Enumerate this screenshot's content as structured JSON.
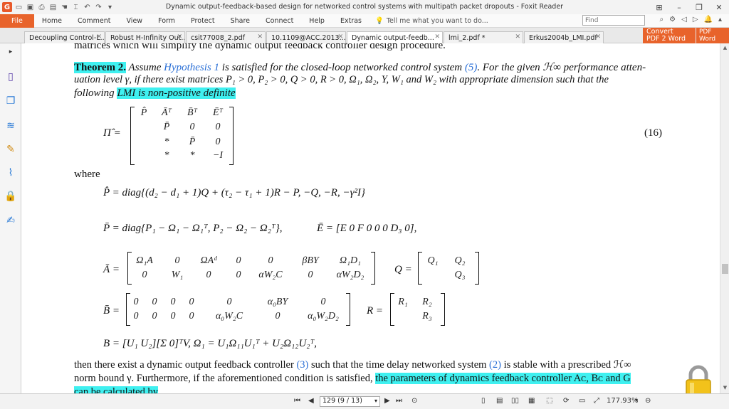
{
  "window": {
    "title": "Dynamic output-feedback-based  design for networked control systems with multipath packet dropouts - Foxit Reader"
  },
  "ribbon": {
    "tabs": [
      "File",
      "Home",
      "Comment",
      "View",
      "Form",
      "Protect",
      "Share",
      "Connect",
      "Help",
      "Extras"
    ],
    "tell_me": "Tell me what you want to do...",
    "find_placeholder": "Find"
  },
  "doc_tabs": [
    {
      "label": "Decoupling Control-L...",
      "active": false
    },
    {
      "label": "Robust H-Infinity Out...",
      "active": false
    },
    {
      "label": "csit77008_2.pdf",
      "active": false
    },
    {
      "label": "10.1109@ACC.2013....",
      "active": false
    },
    {
      "label": "Dynamic output-feedb...",
      "active": true
    },
    {
      "label": "lmi_2.pdf *",
      "active": false
    },
    {
      "label": "Erkus2004b_LMI.pdf",
      "active": false
    }
  ],
  "convert": {
    "line1": "Convert",
    "line2": "PDF 2 Word",
    "badge1": "PDF",
    "badge2": "Word"
  },
  "content": {
    "line0": "matrices which will simplify the dynamic output feedback controller design procedure.",
    "theorem_label": "Theorem 2.",
    "theorem_t1": " Assume ",
    "hyp_link": "Hypothesis 1",
    "theorem_t2": " is satisfied for the closed-loop networked control system ",
    "eq5_link": "(5)",
    "theorem_t3": ". For the given ℋ∞ performance atten-",
    "line2": "uation level γ, if there exist matrices P₁ > 0, P₂ > 0, Q > 0, R > 0, Ω₁, Ω₂, Y, W₁ and W₂ with appropriate dimension such that the",
    "line3_a": "following ",
    "line3_hl": "LMI is non-positive definite",
    "eq_number": "(16)",
    "where": "where",
    "phat": "P̂ = diag{(d₂ − d₁ + 1)Q + (τ₂ − τ₁ + 1)R − P,    −Q,    −R,    −γ²I}",
    "pbar": "P̄ = diag{P₁ − Ω₁ − Ω₁ᵀ,    P₂ − Ω₂ − Ω₂ᵀ},",
    "ebar": "Ē = [E    0    F    0    0    0    D₃    0],",
    "bdef": "B = [U₁   U₂][Σ   0]ᵀV,    Ω₁ = U₁Ω₁₁U₁ᵀ + U₂Ω₁₂U₂ᵀ,",
    "then1_a": "then there exist a dynamic output feedback controller ",
    "eq3_link": "(3)",
    "then1_b": " such that the time delay networked system ",
    "eq2_link": "(2)",
    "then1_c": " is stable with a prescribed ℋ∞",
    "then2_a": "norm bound γ. Furthermore, if the aforementioned condition is satisfied, ",
    "then2_hl": "the parameters of dynamics feedback controller Aᴄ, Bᴄ and G",
    "then3_hl": "can be calculated by"
  },
  "matrices": {
    "pi_lhs": "Π̂ =",
    "pi": [
      [
        "P̂",
        "Āᵀ",
        "B̄ᵀ",
        "Ēᵀ"
      ],
      [
        "",
        "P̄",
        "0",
        "0"
      ],
      [
        "",
        "*",
        "P̄",
        "0"
      ],
      [
        "",
        "*",
        "*",
        "−I"
      ]
    ],
    "abar_lhs": "Ā =",
    "abar": [
      [
        "Ω₁A",
        "0",
        "ΩAᵈ",
        "0",
        "0",
        "βBY",
        "Ω₁D₁"
      ],
      [
        "0",
        "W₁",
        "0",
        "0",
        "αW₂C",
        "0",
        "αW₂D₂"
      ]
    ],
    "q_lhs": "Q =",
    "q": [
      [
        "Q₁",
        "Q₂"
      ],
      [
        "",
        "Q₃"
      ]
    ],
    "bbar_lhs": "B̄ =",
    "bbar": [
      [
        "0",
        "0",
        "0",
        "0",
        "0",
        "α₀BY",
        "0"
      ],
      [
        "0",
        "0",
        "0",
        "0",
        "α₀W₂C",
        "0",
        "α₀W₂D₂"
      ]
    ],
    "r_lhs": "R =",
    "r": [
      [
        "R₁",
        "R₂"
      ],
      [
        "",
        "R₃"
      ]
    ]
  },
  "status": {
    "page_box": "129 (9 / 13)",
    "zoom": "177.93%"
  },
  "colors": {
    "accent": "#e8632b",
    "highlight": "#3ff0f0",
    "link": "#2a6fd6"
  }
}
